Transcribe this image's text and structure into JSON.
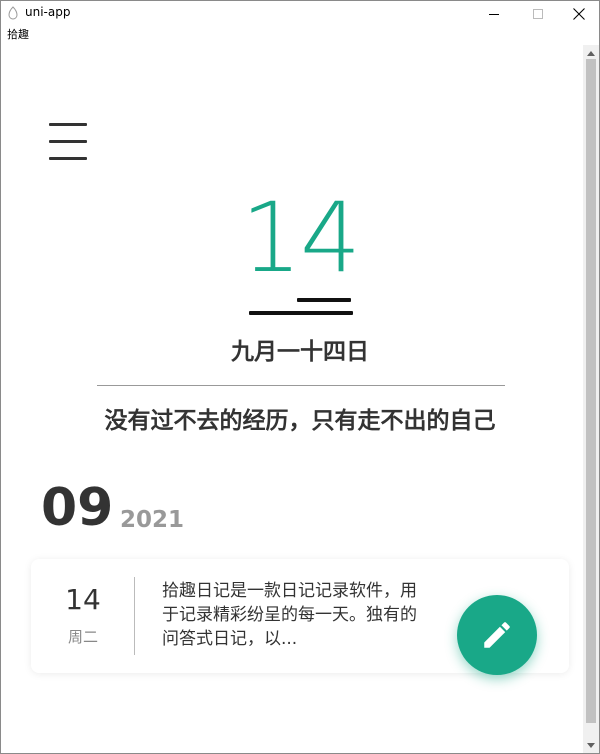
{
  "window": {
    "title": "uni-app",
    "menu_label": "拾趣"
  },
  "header": {
    "day": "14",
    "lunar_date": "九月一十四日",
    "quote": "没有过不去的经历，只有走不出的自己"
  },
  "month_section": {
    "month": "09",
    "year": "2021"
  },
  "entries": [
    {
      "day": "14",
      "weekday": "周二",
      "text": "拾趣日记是一款日记记录软件，用于记录精彩纷呈的每一天。独有的问答式日记，以..."
    }
  ],
  "colors": {
    "accent": "#19a888",
    "text": "#333333",
    "muted": "#999999"
  },
  "icons": {
    "menu": "hamburger-menu-icon",
    "write": "pencil-icon"
  }
}
